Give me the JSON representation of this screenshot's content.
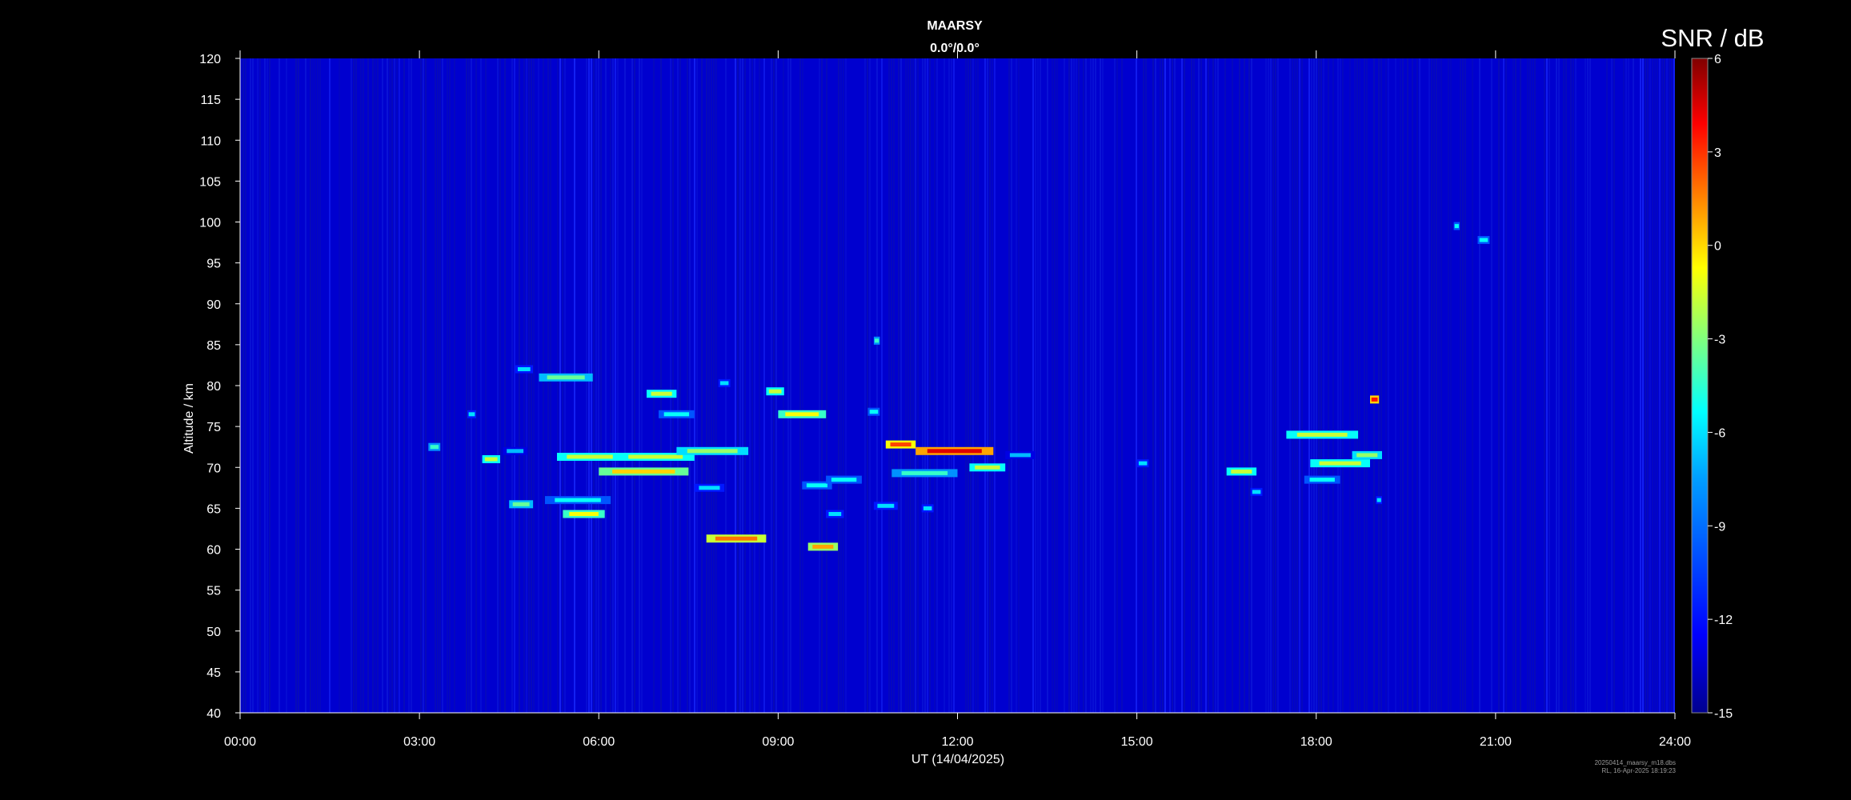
{
  "chart_data": {
    "type": "heatmap",
    "title": "MAARSY",
    "subtitle": "0.0°/0.0°",
    "xlabel": "UT (14/04/2025)",
    "ylabel": "Altitude / km",
    "x_ticks": [
      "00:00",
      "03:00",
      "06:00",
      "09:00",
      "12:00",
      "15:00",
      "18:00",
      "21:00",
      "24:00"
    ],
    "xlim_hours": [
      0,
      24
    ],
    "ylim": [
      40,
      120
    ],
    "y_ticks": [
      40,
      45,
      50,
      55,
      60,
      65,
      70,
      75,
      80,
      85,
      90,
      95,
      100,
      105,
      110,
      115,
      120
    ],
    "colorbar": {
      "label": "SNR / dB",
      "range": [
        -15,
        6
      ],
      "ticks": [
        6,
        3,
        0,
        -3,
        -6,
        -9,
        -12,
        -15
      ],
      "colormap": [
        "#00008f",
        "#0000ff",
        "#00a0ff",
        "#00ffff",
        "#7fff7f",
        "#ffff00",
        "#ff8000",
        "#ff0000",
        "#800000"
      ]
    },
    "background_snr": -13.5,
    "echoes": [
      {
        "t0": 3.15,
        "t1": 3.35,
        "alt": 72.5,
        "snr": -6
      },
      {
        "t0": 3.8,
        "t1": 3.95,
        "alt": 76.5,
        "snr": -8
      },
      {
        "t0": 4.05,
        "t1": 4.35,
        "alt": 71,
        "snr": -3
      },
      {
        "t0": 4.4,
        "t1": 4.8,
        "alt": 72,
        "snr": -9
      },
      {
        "t0": 4.5,
        "t1": 4.9,
        "alt": 65.5,
        "snr": -5
      },
      {
        "t0": 4.6,
        "t1": 4.9,
        "alt": 82,
        "snr": -8
      },
      {
        "t0": 5.0,
        "t1": 5.9,
        "alt": 81,
        "snr": -5
      },
      {
        "t0": 5.3,
        "t1": 6.4,
        "alt": 71.3,
        "snr": -3
      },
      {
        "t0": 5.1,
        "t1": 6.2,
        "alt": 66,
        "snr": -7
      },
      {
        "t0": 5.4,
        "t1": 6.1,
        "alt": 64.3,
        "snr": -2
      },
      {
        "t0": 6.0,
        "t1": 7.5,
        "alt": 69.5,
        "snr": -1
      },
      {
        "t0": 6.3,
        "t1": 7.6,
        "alt": 71.3,
        "snr": -3
      },
      {
        "t0": 7.3,
        "t1": 8.5,
        "alt": 72,
        "snr": -4
      },
      {
        "t0": 6.8,
        "t1": 7.3,
        "alt": 79,
        "snr": -3
      },
      {
        "t0": 7.0,
        "t1": 7.6,
        "alt": 76.5,
        "snr": -7
      },
      {
        "t0": 7.6,
        "t1": 8.1,
        "alt": 67.5,
        "snr": -8
      },
      {
        "t0": 7.8,
        "t1": 8.8,
        "alt": 61.3,
        "snr": 1
      },
      {
        "t0": 8.8,
        "t1": 9.1,
        "alt": 79.3,
        "snr": -3
      },
      {
        "t0": 8.0,
        "t1": 8.2,
        "alt": 80.3,
        "snr": -8
      },
      {
        "t0": 9.0,
        "t1": 9.8,
        "alt": 76.5,
        "snr": -2
      },
      {
        "t0": 9.4,
        "t1": 9.9,
        "alt": 67.8,
        "snr": -7
      },
      {
        "t0": 9.8,
        "t1": 10.4,
        "alt": 68.5,
        "snr": -7
      },
      {
        "t0": 9.8,
        "t1": 10.1,
        "alt": 64.3,
        "snr": -8
      },
      {
        "t0": 9.5,
        "t1": 10.0,
        "alt": 60.3,
        "snr": 0
      },
      {
        "t0": 10.5,
        "t1": 10.7,
        "alt": 76.8,
        "snr": -7
      },
      {
        "t0": 10.6,
        "t1": 10.7,
        "alt": 85.5,
        "snr": -6
      },
      {
        "t0": 10.6,
        "t1": 11.0,
        "alt": 65.3,
        "snr": -8
      },
      {
        "t0": 10.8,
        "t1": 11.3,
        "alt": 72.8,
        "snr": 2
      },
      {
        "t0": 10.9,
        "t1": 12.0,
        "alt": 69.3,
        "snr": -6
      },
      {
        "t0": 11.3,
        "t1": 12.6,
        "alt": 72,
        "snr": 4
      },
      {
        "t0": 12.2,
        "t1": 12.8,
        "alt": 70,
        "snr": -3
      },
      {
        "t0": 11.4,
        "t1": 11.6,
        "alt": 65,
        "snr": -8
      },
      {
        "t0": 12.8,
        "t1": 13.3,
        "alt": 71.5,
        "snr": -9
      },
      {
        "t0": 15.0,
        "t1": 15.2,
        "alt": 70.5,
        "snr": -8
      },
      {
        "t0": 16.5,
        "t1": 17.0,
        "alt": 69.5,
        "snr": -3
      },
      {
        "t0": 16.9,
        "t1": 17.1,
        "alt": 67,
        "snr": -8
      },
      {
        "t0": 17.5,
        "t1": 18.7,
        "alt": 74,
        "snr": -3
      },
      {
        "t0": 17.9,
        "t1": 18.9,
        "alt": 70.5,
        "snr": -3
      },
      {
        "t0": 18.6,
        "t1": 19.1,
        "alt": 71.5,
        "snr": -4
      },
      {
        "t0": 17.8,
        "t1": 18.4,
        "alt": 68.5,
        "snr": -7
      },
      {
        "t0": 18.9,
        "t1": 19.05,
        "alt": 78.3,
        "snr": 3
      },
      {
        "t0": 19.0,
        "t1": 19.1,
        "alt": 66,
        "snr": -8
      },
      {
        "t0": 20.3,
        "t1": 20.4,
        "alt": 99.5,
        "snr": -7
      },
      {
        "t0": 20.7,
        "t1": 20.9,
        "alt": 97.8,
        "snr": -7
      }
    ]
  },
  "footer": {
    "line1": "20250414_maarsy_m18.dbs",
    "line2": "RL, 16-Apr-2025 18:19:23"
  }
}
